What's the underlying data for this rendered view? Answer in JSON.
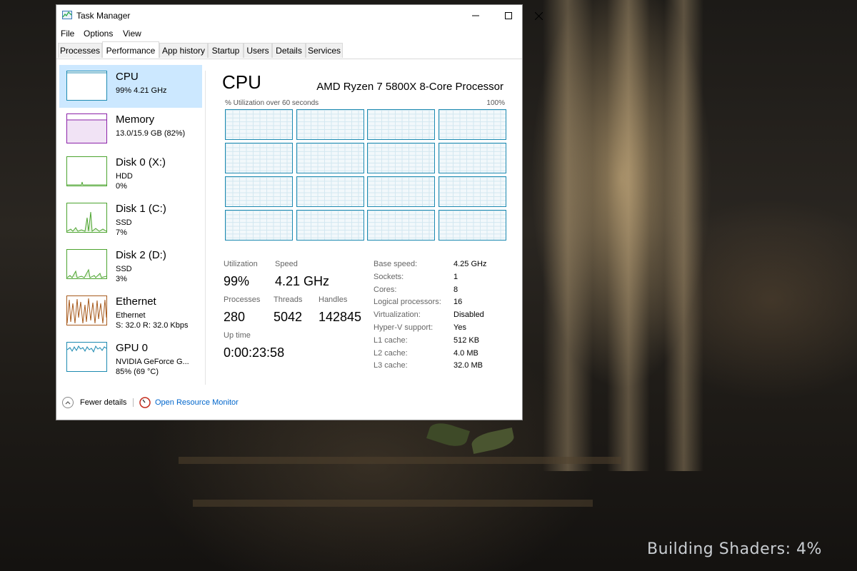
{
  "window": {
    "title": "Task Manager",
    "controls": {
      "minimize": "─",
      "maximize": "☐",
      "close": "✕"
    }
  },
  "menu": [
    "File",
    "Options",
    "View"
  ],
  "tabs": [
    "Processes",
    "Performance",
    "App history",
    "Startup",
    "Users",
    "Details",
    "Services"
  ],
  "active_tab": "Performance",
  "sidebar": {
    "items": [
      {
        "title": "CPU",
        "line1": "99% 4.21 GHz",
        "line2": "",
        "graph_color": "#1d8ab1",
        "selected": true
      },
      {
        "title": "Memory",
        "line1": "13.0/15.9 GB (82%)",
        "line2": "",
        "graph_color": "#8b22a8",
        "selected": false
      },
      {
        "title": "Disk 0 (X:)",
        "line1": "HDD",
        "line2": "0%",
        "graph_color": "#4ca42f",
        "selected": false
      },
      {
        "title": "Disk 1 (C:)",
        "line1": "SSD",
        "line2": "7%",
        "graph_color": "#4ca42f",
        "selected": false
      },
      {
        "title": "Disk 2 (D:)",
        "line1": "SSD",
        "line2": "3%",
        "graph_color": "#4ca42f",
        "selected": false
      },
      {
        "title": "Ethernet",
        "line1": "Ethernet",
        "line2": "S: 32.0  R: 32.0 Kbps",
        "graph_color": "#a75a1c",
        "selected": false
      },
      {
        "title": "GPU 0",
        "line1": "NVIDIA GeForce G...",
        "line2": "85% (69 °C)",
        "graph_color": "#1d8ab1",
        "selected": false
      }
    ]
  },
  "main": {
    "heading": "CPU",
    "model": "AMD Ryzen 7 5800X 8-Core Processor",
    "graph_label": "% Utilization over 60 seconds",
    "graph_max": "100%",
    "logical_graphs": 16,
    "utilization_color": "#1d8ab1",
    "stats": {
      "utilization_label": "Utilization",
      "utilization": "99%",
      "speed_label": "Speed",
      "speed": "4.21 GHz",
      "processes_label": "Processes",
      "processes": "280",
      "threads_label": "Threads",
      "threads": "5042",
      "handles_label": "Handles",
      "handles": "142845",
      "uptime_label": "Up time",
      "uptime": "0:00:23:58"
    },
    "specs": [
      {
        "k": "Base speed:",
        "v": "4.25 GHz"
      },
      {
        "k": "Sockets:",
        "v": "1"
      },
      {
        "k": "Cores:",
        "v": "8"
      },
      {
        "k": "Logical processors:",
        "v": "16"
      },
      {
        "k": "Virtualization:",
        "v": "Disabled"
      },
      {
        "k": "Hyper-V support:",
        "v": "Yes"
      },
      {
        "k": "L1 cache:",
        "v": "512 KB"
      },
      {
        "k": "L2 cache:",
        "v": "4.0 MB"
      },
      {
        "k": "L3 cache:",
        "v": "32.0 MB"
      }
    ]
  },
  "footer": {
    "fewer_details": "Fewer details",
    "open_resource_monitor": "Open Resource Monitor"
  },
  "game_overlay": {
    "status": "Building Shaders: 4%"
  }
}
